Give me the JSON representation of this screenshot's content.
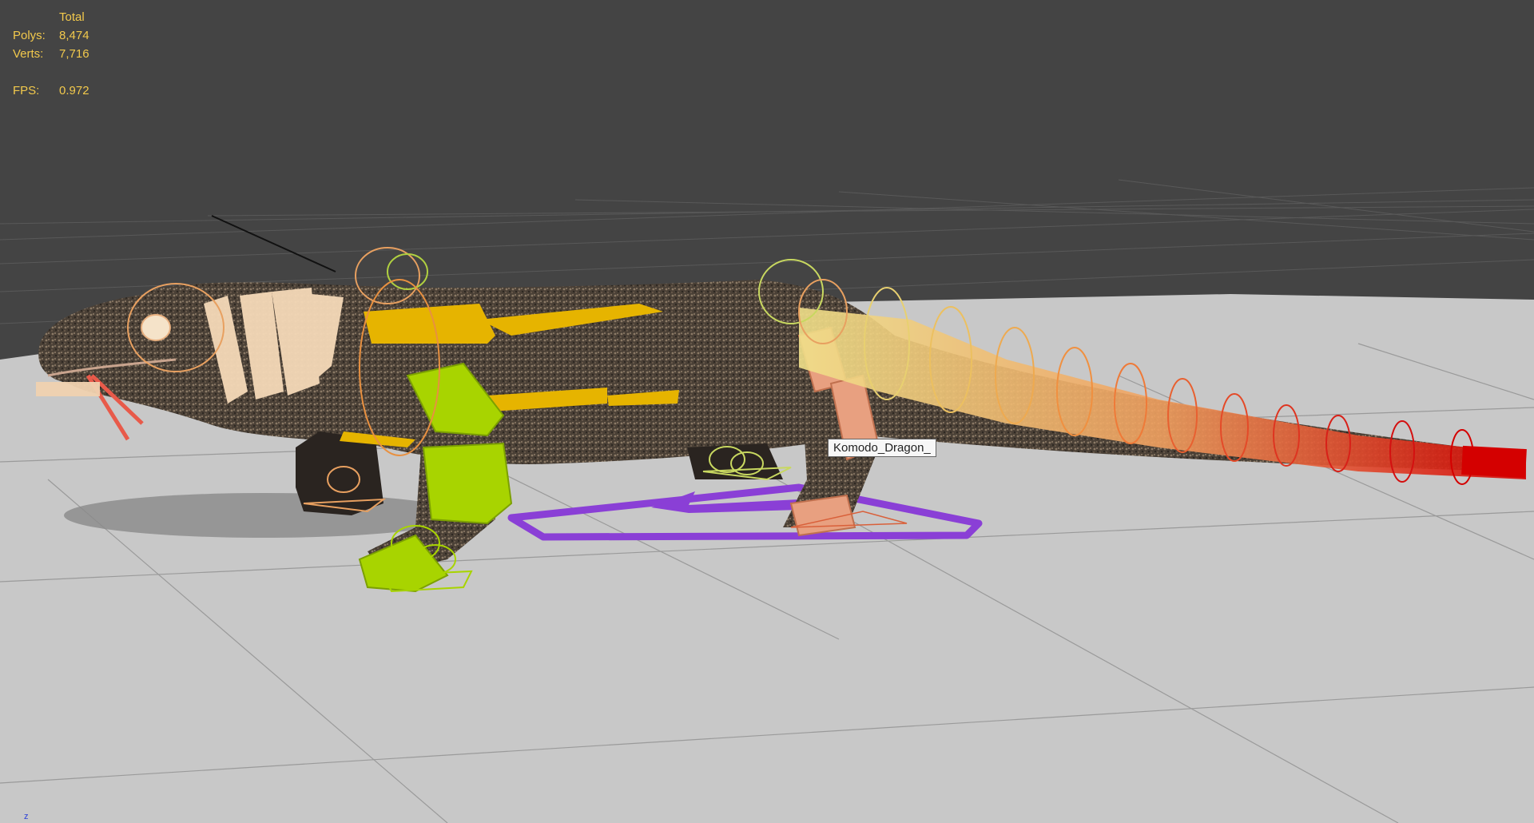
{
  "hud": {
    "header": "Total",
    "polys_label": "Polys:",
    "polys_value": "8,474",
    "verts_label": "Verts:",
    "verts_value": "7,716",
    "fps_label": "FPS:",
    "fps_value": "0.972"
  },
  "tooltip": {
    "text": "Komodo_Dragon_"
  },
  "axis_indicator": {
    "label": "z"
  },
  "colors": {
    "viewport_background": "#444444",
    "floor_plane": "#c8c8c8",
    "hud_text": "#f2c94c",
    "tail_controls_start": "#f0e08a",
    "tail_controls_end": "#d40000",
    "front_leg_control": "#a8d400",
    "rear_leg_control": "#e8a080",
    "neck_controls": "#f5d9b8",
    "spine_controls": "#e6b400",
    "foot_ik_path": "#8a3fd6"
  }
}
